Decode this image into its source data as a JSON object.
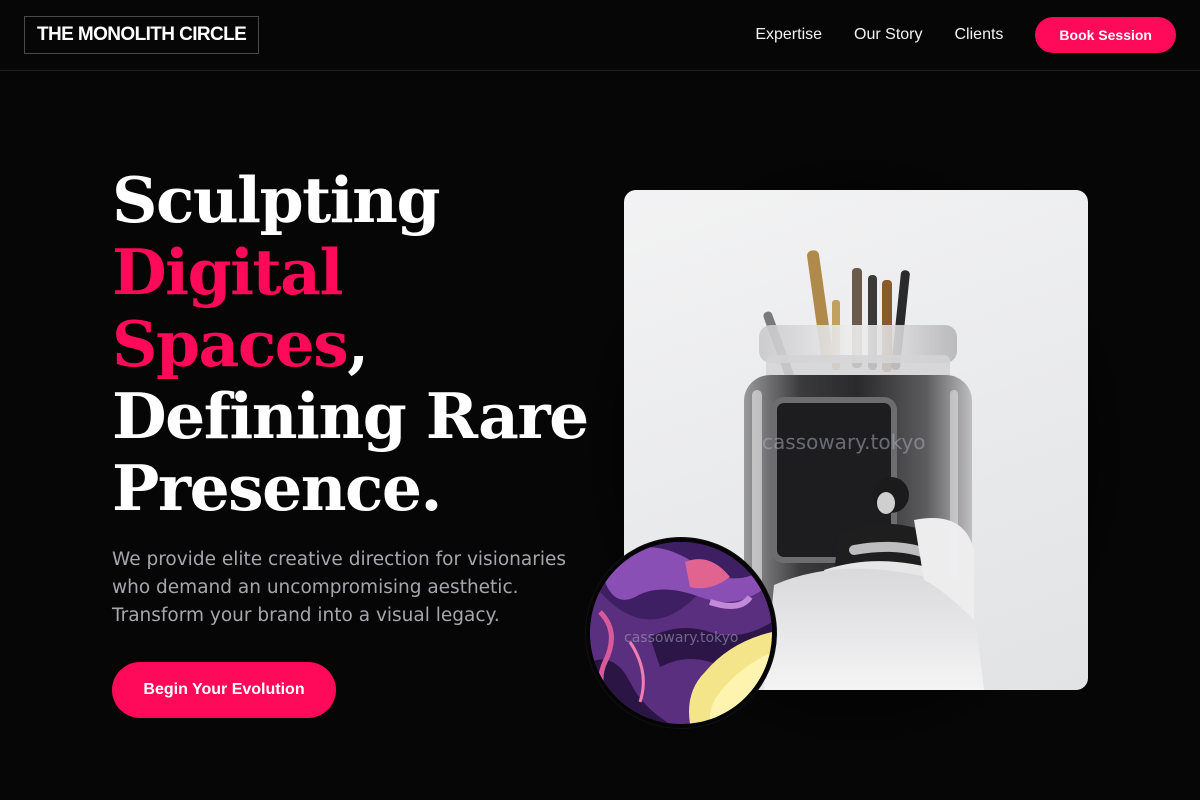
{
  "header": {
    "logo": "THE MONOLITH CIRCLE",
    "nav": [
      "Expertise",
      "Our Story",
      "Clients"
    ],
    "book_label": "Book Session"
  },
  "hero": {
    "headline": {
      "line1": "Sculpting",
      "line2": "Digital",
      "line3_accent": "Spaces",
      "line3_rest": ",",
      "line4": "Defining Rare",
      "line5": "Presence."
    },
    "subtext": "We provide elite creative direction for visionaries who demand an uncompromising aesthetic. Transform your brand into a visual legacy.",
    "cta_label": "Begin Your Evolution"
  },
  "media": {
    "photo_watermark": "cassowary.tokyo",
    "circle_watermark": "cassowary.tokyo"
  },
  "colors": {
    "accent": "#ff0a5a",
    "background": "#060606",
    "muted_text": "#a6a6ad"
  }
}
